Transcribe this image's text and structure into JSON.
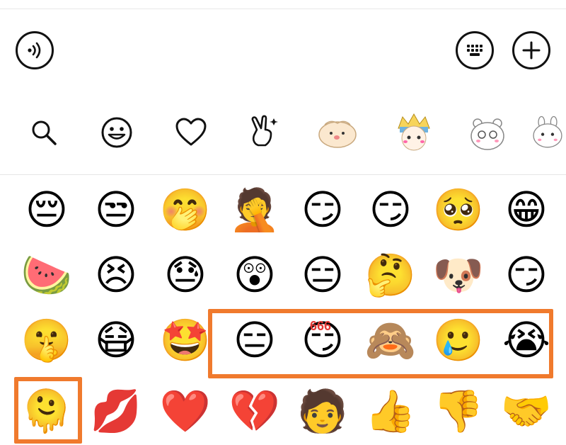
{
  "toolbar": {
    "voice_icon": "voice-icon",
    "keyboard_icon": "keyboard-icon",
    "plus_icon": "plus-icon"
  },
  "tabs": [
    {
      "name": "search-icon",
      "glyph": "⚲"
    },
    {
      "name": "emoji-face-icon",
      "glyph": "☺"
    },
    {
      "name": "heart-icon",
      "glyph": "♡"
    },
    {
      "name": "victory-hand-icon",
      "glyph": "✌"
    },
    {
      "name": "sticker-bun",
      "glyph": "·ᴗ·"
    },
    {
      "name": "sticker-anime",
      "glyph": "◕‿◕"
    },
    {
      "name": "sticker-bear",
      "glyph": "•ᴥ•"
    },
    {
      "name": "sticker-bunny",
      "glyph": "•ω•"
    }
  ],
  "emoji_rows": [
    [
      "😔",
      "😒",
      "🤭",
      "🤦",
      "😏",
      "😏",
      "🥺",
      "😁"
    ],
    [
      "🍉",
      "😣",
      "😓",
      "😲",
      "😑",
      "🤔",
      "🐶",
      "😏"
    ],
    [
      "🤫",
      "😷",
      "🤩",
      "😑",
      "😏",
      "🙈",
      "🥲",
      "😭"
    ],
    [
      "🫠",
      "💋",
      "❤️",
      "💔",
      "🧑",
      "👍",
      "👎",
      "🤝"
    ]
  ],
  "highlight_text": "666",
  "colors": {
    "highlight": "#f07a2d",
    "icon_stroke": "#111111"
  }
}
